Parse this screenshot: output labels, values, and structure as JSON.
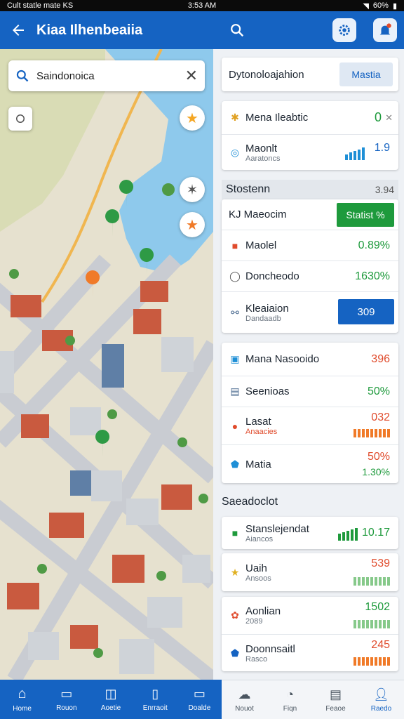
{
  "status_bar": {
    "left": "Cult statle mate KS",
    "time": "3:53 AM",
    "battery": "60%"
  },
  "app_bar": {
    "title": "Kiaa Ilhenbeaiia"
  },
  "map": {
    "search_value": "Saindonoica"
  },
  "panel": {
    "top_card": {
      "title": "Dytonoloajahion",
      "button": "Mastia"
    },
    "card1": [
      {
        "label": "Mena Ileabtic",
        "value": "0",
        "icon": "bird-icon"
      },
      {
        "label": "Maonlt",
        "sub": "Aaratoncs",
        "value": "1.9",
        "icon": "signal-icon"
      }
    ],
    "section1": {
      "title": "Stostenn",
      "value": "3.94"
    },
    "card2": [
      {
        "label": "KJ Maeocim",
        "button": "Statist %"
      },
      {
        "label": "Maolel",
        "value": "0.89%",
        "icon": "stop-icon"
      },
      {
        "label": "Doncheodo",
        "value": "1630%",
        "icon": "clock-icon"
      },
      {
        "label": "Kleaiaion",
        "sub": "Dandaadb",
        "button": "309",
        "icon": "link-icon"
      }
    ],
    "card3": [
      {
        "label": "Mana Nasooido",
        "value": "396",
        "icon": "square-icon"
      },
      {
        "label": "Seenioas",
        "value": "50%",
        "icon": "image-icon"
      },
      {
        "label": "Lasat",
        "sub": "Anaacies",
        "value": "032",
        "icon": "pin-icon"
      },
      {
        "label": "Matia",
        "value": "50%",
        "value2": "1.30%",
        "icon": "shield-icon"
      }
    ],
    "section2": {
      "title": "Saeadoclot"
    },
    "card4": [
      {
        "label": "Stanslejendat",
        "sub": "Aiancos",
        "value": "10.17",
        "icon": "flag-icon"
      }
    ],
    "card5": [
      {
        "label": "Uaih",
        "sub": "Ansoos",
        "value": "539",
        "icon": "star-icon"
      }
    ],
    "card6": [
      {
        "label": "Aonlian",
        "sub": "2089",
        "value": "1502",
        "icon": "cluster-icon"
      },
      {
        "label": "Doonnsaitl",
        "sub": "Rasco",
        "value": "245",
        "icon": "shield-icon"
      }
    ]
  },
  "nav": {
    "left": [
      "Home",
      "Rouon",
      "Aoetie",
      "Enrraoit",
      "Doalde"
    ],
    "right": [
      "Nouot",
      "Fiqn",
      "Feaoe",
      "Raedo"
    ]
  },
  "colors": {
    "primary": "#1563c2",
    "green": "#1e9a3c",
    "red": "#e04b2c"
  }
}
